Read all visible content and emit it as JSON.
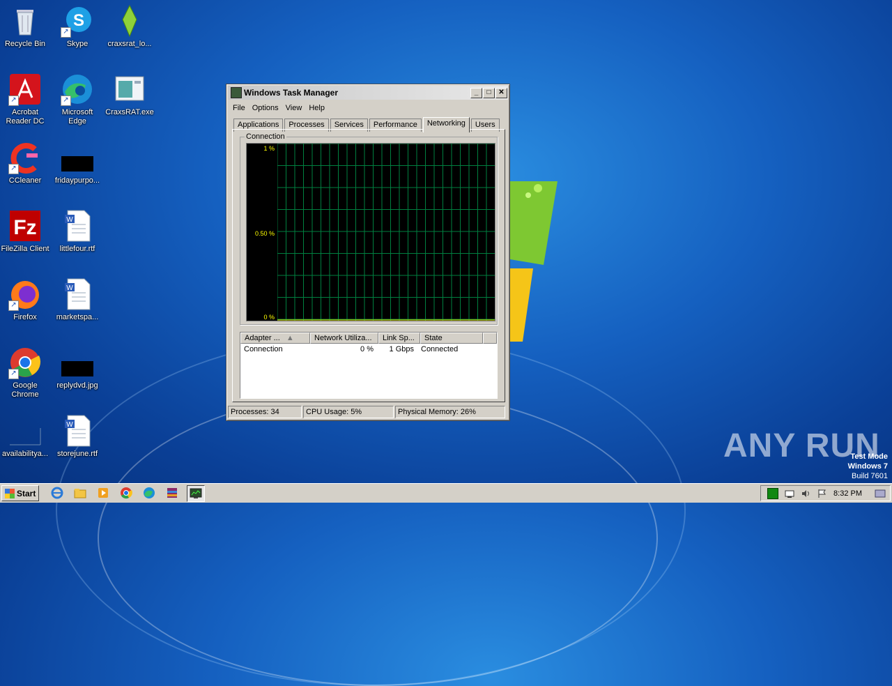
{
  "desktop": {
    "icons": [
      {
        "label": "Recycle Bin"
      },
      {
        "label": "Skype"
      },
      {
        "label": "craxsrat_lo..."
      },
      {
        "label": "Acrobat Reader DC"
      },
      {
        "label": "Microsoft Edge"
      },
      {
        "label": "CraxsRAT.exe"
      },
      {
        "label": "CCleaner"
      },
      {
        "label": "fridaypurpo..."
      },
      {
        "label": "FileZilla Client"
      },
      {
        "label": "littlefour.rtf"
      },
      {
        "label": "Firefox"
      },
      {
        "label": "marketspa..."
      },
      {
        "label": "Google Chrome"
      },
      {
        "label": "replydvd.jpg"
      },
      {
        "label": "availabilitya..."
      },
      {
        "label": "storejune.rtf"
      }
    ]
  },
  "task_manager": {
    "title": "Windows Task Manager",
    "menu": [
      "File",
      "Options",
      "View",
      "Help"
    ],
    "tabs": [
      "Applications",
      "Processes",
      "Services",
      "Performance",
      "Networking",
      "Users"
    ],
    "active_tab": "Networking",
    "group_label": "Connection",
    "graph": {
      "y_labels": [
        "1 %",
        "0.50 %",
        "0 %"
      ],
      "grid_color": "#008040"
    },
    "columns": [
      "Adapter ...",
      "Network Utiliza...",
      "Link Sp...",
      "State"
    ],
    "rows": [
      {
        "adapter": "Connection",
        "utilization": "0 %",
        "link_speed": "1 Gbps",
        "state": "Connected"
      }
    ],
    "status": {
      "processes": "Processes: 34",
      "cpu": "CPU Usage: 5%",
      "memory": "Physical Memory: 26%"
    }
  },
  "watermark": {
    "brand": "ANY RUN",
    "line1": "Test Mode",
    "line2": "Windows 7",
    "line3": "Build 7601"
  },
  "taskbar": {
    "start_label": "Start",
    "clock": "8:32 PM"
  }
}
